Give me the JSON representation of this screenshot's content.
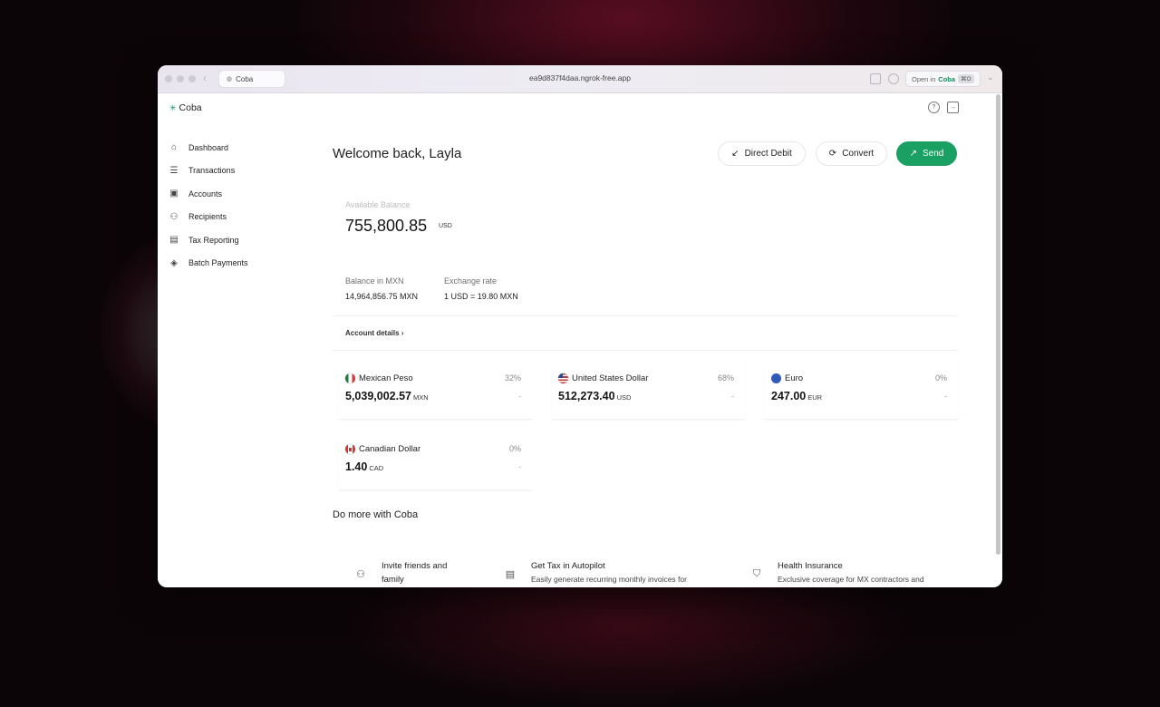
{
  "browser": {
    "tab_title": "Coba",
    "url": "ea9d837f4daa.ngrok-free.app",
    "open_in_prefix": "Open in",
    "open_in_app": "Coba",
    "open_in_shortcut": "⌘O"
  },
  "app": {
    "brand": "Coba"
  },
  "sidebar": {
    "items": [
      {
        "label": "Dashboard",
        "icon": "home-icon"
      },
      {
        "label": "Transactions",
        "icon": "list-icon"
      },
      {
        "label": "Accounts",
        "icon": "accounts-icon"
      },
      {
        "label": "Recipients",
        "icon": "users-icon"
      },
      {
        "label": "Tax Reporting",
        "icon": "document-icon"
      },
      {
        "label": "Batch Payments",
        "icon": "layers-icon"
      }
    ]
  },
  "header": {
    "welcome": "Welcome back, Layla",
    "direct_debit_label": "Direct Debit",
    "convert_label": "Convert",
    "send_label": "Send"
  },
  "balance": {
    "label": "Available Balance",
    "value": "755,800.85",
    "currency": "USD",
    "mxn_label": "Balance in MXN",
    "mxn_value": "14,964,856.75 MXN",
    "rate_label": "Exchange rate",
    "rate_value": "1 USD = 19.80 MXN",
    "account_details_label": "Account details"
  },
  "accounts": [
    {
      "name": "Mexican Peso",
      "percent": "32%",
      "amount": "5,039,002.57",
      "currency": "MXN",
      "change": "-"
    },
    {
      "name": "United States Dollar",
      "percent": "68%",
      "amount": "512,273.40",
      "currency": "USD",
      "change": "-"
    },
    {
      "name": "Euro",
      "percent": "0%",
      "amount": "247.00",
      "currency": "EUR",
      "change": "-"
    },
    {
      "name": "Canadian Dollar",
      "percent": "0%",
      "amount": "1.40",
      "currency": "CAD",
      "change": "-"
    }
  ],
  "do_more": {
    "title": "Do more with Coba",
    "items": [
      {
        "title": "Invite friends and",
        "title_line2": "family",
        "desc": ""
      },
      {
        "title": "Get Tax in Autopilot",
        "desc": "Easily generate recurring monthly invoices for"
      },
      {
        "title": "Health Insurance",
        "desc": "Exclusive coverage for MX contractors and"
      }
    ]
  },
  "colors": {
    "accent": "#19a062",
    "brand_star": "#1a8c5f"
  }
}
